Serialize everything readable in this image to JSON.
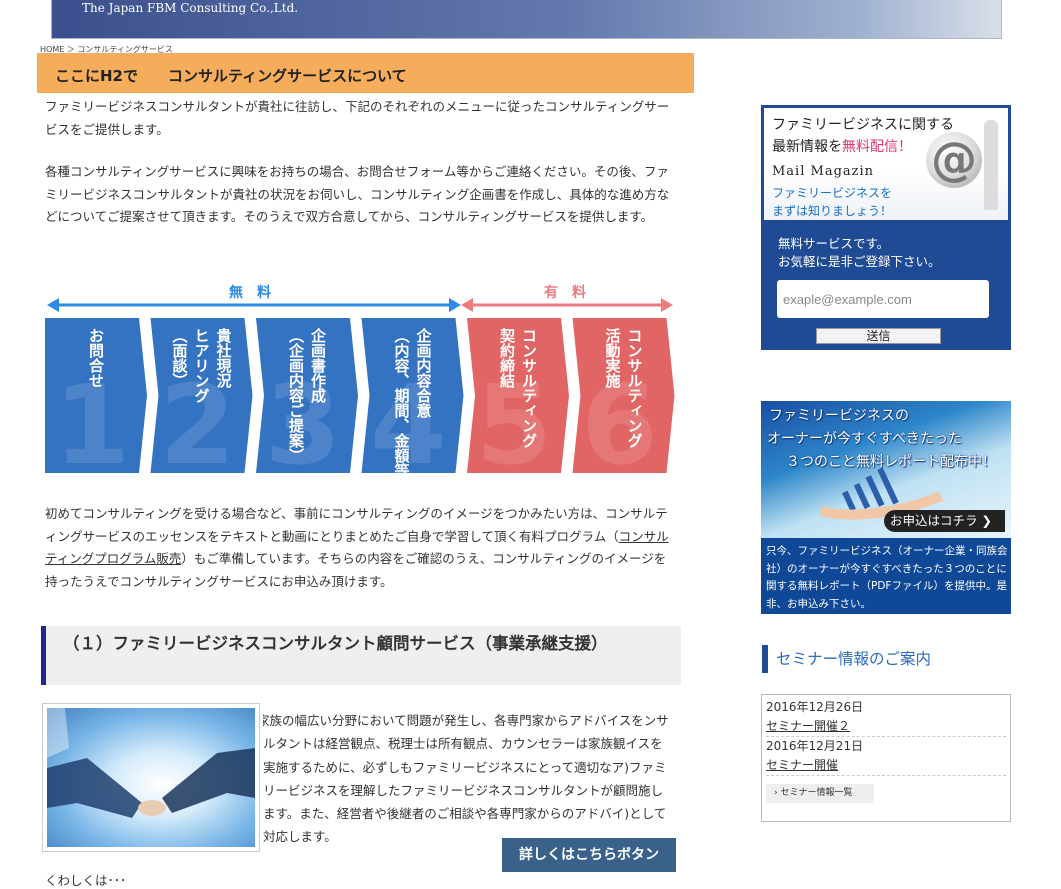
{
  "header": {
    "company": "The Japan FBM Consulting Co.,Ltd."
  },
  "breadcrumb": {
    "home": "HOME",
    "sep": " ＞ ",
    "current": "コンサルティングサービス"
  },
  "page_title": "ここにH2で　　コンサルティングサービスについて",
  "intro": {
    "p1": "ファミリービジネスコンサルタントが貴社に往訪し、下記のそれぞれのメニューに従ったコンサルティングサービスをご提供します。",
    "p2": "各種コンサルティングサービスに興味をお持ちの場合、お問合せフォーム等からご連絡ください。その後、ファミリービジネスコンサルタントが貴社の状況をお伺いし、コンサルティング企画書を作成し、具体的な進め方などについてご提案させて頂きます。そのうえで双方合意してから、コンサルティングサービスを提供します。"
  },
  "flow": {
    "free_label": "無　料",
    "paid_label": "有　料",
    "colors": {
      "free": "#3472c2",
      "paid": "#e26565",
      "free_arrow": "#2e8ae4",
      "paid_arrow": "#ef7a80"
    },
    "steps": [
      {
        "num": "1",
        "col1": "お問合せ",
        "col2": ""
      },
      {
        "num": "2",
        "col1": "貴社現況",
        "col2": "ヒアリング",
        "col3": "（面談）"
      },
      {
        "num": "3",
        "col1": "企画書作成",
        "col2": "（企画内容ご提案）"
      },
      {
        "num": "4",
        "col1": "企画内容合意",
        "col2": "（内容、期間、金額等）"
      },
      {
        "num": "5",
        "col1": "コンサルティング",
        "col2": "契約締結"
      },
      {
        "num": "6",
        "col1": "コンサルティング",
        "col2": "活動実施"
      }
    ]
  },
  "para3": {
    "before": "初めてコンサルティングを受ける場合など、事前にコンサルティングのイメージをつかみたい方は、コンサルティングサービスのエッセンスをテキストと動画にとりまとめたご自身で学習して頂く有料プログラム（",
    "link": "コンサルティングプログラム販売",
    "after": "）もご準備しています。そちらの内容をご確認のうえ、コンサルティングのイメージを持ったうえでコンサルティングサービスにお申込み頂けます。"
  },
  "section1": {
    "title": "（１）ファミリービジネスコンサルタント顧問サービス（事業承継支援）",
    "body": "家族の幅広い分野において問題が発生し、各専門家からアドバイスをンサルタントは経営観点、税理士は所有観点、カウンセラーは家族観イスを実施するために、必ずしもファミリービジネスにとって適切なア)ファミリービジネスを理解したファミリービジネスコンサルタントが顧問施します。また、経営者や後継者のご相談や各専門家からのアドバイ)として対応します。",
    "detail_button": "詳しくはこちらボタン",
    "more": "くわしくは･･･"
  },
  "mail_magazine": {
    "line1": "ファミリービジネスに関する",
    "line2_a": "最新情報を",
    "line2_b": "無料配信！",
    "en": "Mail Magazin",
    "sub1": "ファミリービジネスを",
    "sub2": "まずは知りましょう！",
    "at": "@",
    "free1": "無料サービスです。",
    "free2": "お気軽に是非ご登録下さい。",
    "placeholder": "exaple@example.com",
    "submit": "送信"
  },
  "report": {
    "t1": "ファミリービジネスの",
    "t2": "オーナーが今すぐすべきたった",
    "t3": "３つのこと無料レポート配布中！",
    "button": "お申込はコチラ ❯",
    "text": "只今、ファミリービジネス（オーナー企業・同族会社）のオーナーが今すぐすべきたった３つのことに関する無料レポート（PDFファイル）を提供中。是非、お申込み下さい。"
  },
  "seminar": {
    "heading": "セミナー情報のご案内",
    "items": [
      {
        "date": "2016年12月26日",
        "title": "セミナー開催２"
      },
      {
        "date": "2016年12月21日",
        "title": "セミナー開催"
      }
    ],
    "all_link": "› セミナー情報一覧"
  }
}
